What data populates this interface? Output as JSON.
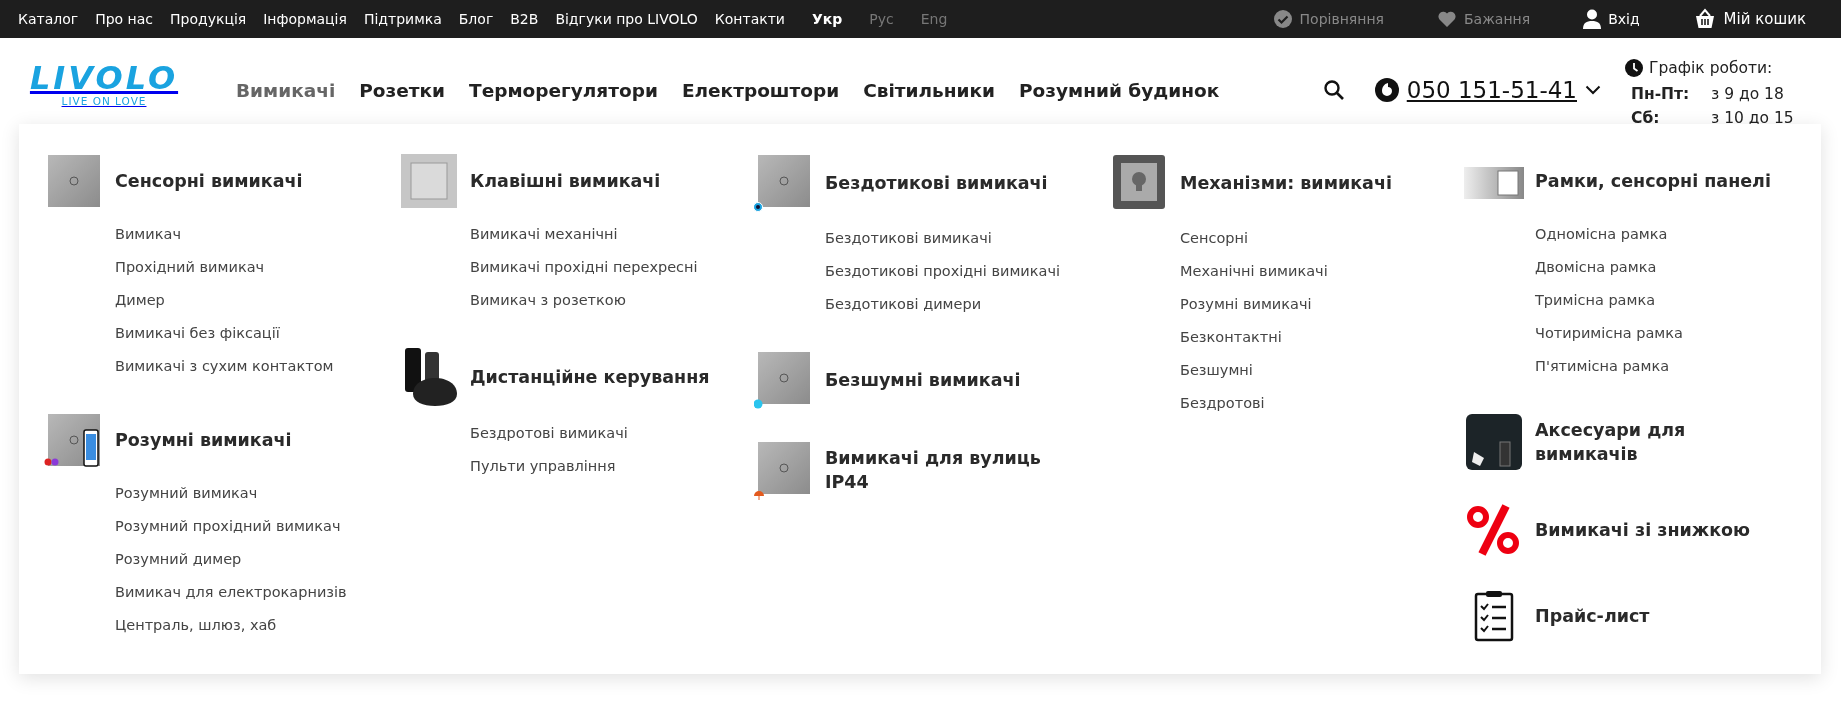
{
  "top_bar": {
    "links": [
      "Каталог",
      "Про нас",
      "Продукція",
      "Інформація",
      "Підтримка",
      "Блог",
      "B2B",
      "Відгуки про LIVOLO",
      "Контакти"
    ],
    "languages": [
      {
        "label": "Укр",
        "selected": true
      },
      {
        "label": "Рус",
        "selected": false
      },
      {
        "label": "Eng",
        "selected": false
      }
    ],
    "actions": [
      {
        "kind": "compare",
        "label": "Порівняння",
        "disabled": true
      },
      {
        "kind": "wishlist",
        "label": "Бажання",
        "disabled": true
      },
      {
        "kind": "login",
        "label": "Вхід",
        "disabled": false
      },
      {
        "kind": "cart",
        "label": "Мій кошик",
        "disabled": false
      }
    ]
  },
  "header": {
    "logo": {
      "name": "LIVOLO",
      "tagline": "LIVE ON LOVE"
    },
    "nav": [
      {
        "label": "Вимикачі",
        "selected": true
      },
      {
        "label": "Розетки",
        "selected": false
      },
      {
        "label": "Терморегулятори",
        "selected": false
      },
      {
        "label": "Електроштори",
        "selected": false
      },
      {
        "label": "Світильники",
        "selected": false
      },
      {
        "label": "Розумний будинок",
        "selected": false
      }
    ],
    "phone": "050 151-51-41",
    "schedule": {
      "title": "Графік роботи:",
      "rows": [
        {
          "days": "Пн-Пт:",
          "hours": "з 9 до 18"
        },
        {
          "days": "Сб:",
          "hours": "з 10 до 15"
        }
      ]
    }
  },
  "mega_menu": {
    "columns": [
      [
        {
          "kind": "touch-panel",
          "title": "Сенсорні вимикачі",
          "items": [
            "Вимикач",
            "Прохідний вимикач",
            "Димер",
            "Вимикачі без фіксації",
            "Вимикачі з сухим контактом"
          ]
        },
        {
          "kind": "smart-panel",
          "title": "Розумні вимикачі",
          "items": [
            "Розумний вимикач",
            "Розумний прохідний вимикач",
            "Розумний димер",
            "Вимикач для електрокарнизів",
            "Централь, шлюз, хаб"
          ]
        }
      ],
      [
        {
          "kind": "key-switch",
          "title": "Клавішні вимикачі",
          "items": [
            "Вимикачі механічні",
            "Вимикачі прохідні перехресні",
            "Вимикач з розеткою"
          ]
        },
        {
          "kind": "remote",
          "title": "Дистанційне керування",
          "items": [
            "Бездротові вимикачі",
            "Пульти управління"
          ]
        }
      ],
      [
        {
          "kind": "touchless-panel",
          "title": "Бездотикові вимикачі",
          "items": [
            "Бездотикові вимикачі",
            "Бездотикові прохідні вимикачі",
            "Бездотикові димери"
          ]
        },
        {
          "kind": "silent-panel",
          "title": "Безшумні вимикачі"
        },
        {
          "kind": "outdoor-panel",
          "title": "Вимикачі для вулиць IP44"
        }
      ],
      [
        {
          "kind": "mechanism",
          "title": "Механізми: вимикачі",
          "items": [
            "Сенсорні",
            "Механічні вимикачі",
            "Розумні вимикачі",
            "Безконтактні",
            "Безшумні",
            "Бездротові"
          ]
        }
      ],
      [
        {
          "kind": "frame",
          "title": "Рамки, сенсорні панелі",
          "items": [
            "Одномісна рамка",
            "Двомісна рамка",
            "Тримісна рамка",
            "Чотиримісна рамка",
            "П'ятимісна рамка"
          ]
        },
        {
          "kind": "accessory",
          "title": "Аксесуари для вимикачів"
        },
        {
          "kind": "percent",
          "title": "Вимикачі зі знижкою"
        },
        {
          "kind": "checklist",
          "title": "Прайс-лист"
        }
      ]
    ]
  }
}
